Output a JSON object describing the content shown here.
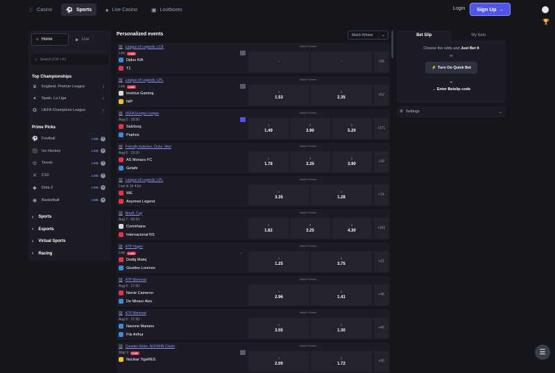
{
  "topnav": [
    {
      "label": "Casino",
      "icon": "casino-icon",
      "glyph": "♢",
      "active": false
    },
    {
      "label": "Sports",
      "icon": "sports-icon",
      "glyph": "⚽",
      "active": true
    },
    {
      "label": "Live Casino",
      "icon": "live-casino-icon",
      "glyph": "♠",
      "active": false
    },
    {
      "label": "Lootboxes",
      "icon": "lootbox-icon",
      "glyph": "▣",
      "active": false
    }
  ],
  "header": {
    "login": "Login",
    "signup": "Sign Up",
    "signup_arrow": "→"
  },
  "left": {
    "home": "Home",
    "live": "Live",
    "search_placeholder": "Search (Ctrl + K)",
    "top_title": "Top Championships",
    "champs": [
      {
        "label": "England. Premier League",
        "icon": "premier-league-icon",
        "glyph": "♛"
      },
      {
        "label": "Spain. La Liga",
        "icon": "la-liga-icon",
        "glyph": "✦"
      },
      {
        "label": "UEFA Champions League",
        "icon": "champions-league-icon",
        "glyph": "✪"
      }
    ],
    "prime_title": "Prime Picks",
    "picks": [
      {
        "label": "Football",
        "icon": "football-icon",
        "glyph": "⚽"
      },
      {
        "label": "Ice Hockey",
        "icon": "hockey-icon",
        "glyph": "⚫"
      },
      {
        "label": "Tennis",
        "icon": "tennis-icon",
        "glyph": "◎"
      },
      {
        "label": "CS2",
        "icon": "cs2-icon",
        "glyph": "✕"
      },
      {
        "label": "Dota 2",
        "icon": "dota-icon",
        "glyph": "◆"
      },
      {
        "label": "Basketball",
        "icon": "basketball-icon",
        "glyph": "◉"
      }
    ],
    "live_badge": "LIVE",
    "plus": "+",
    "cats": [
      "Sports",
      "Esports",
      "Virtual Sports",
      "Racing"
    ]
  },
  "main": {
    "title": "Personalized events",
    "market": "Match Winner",
    "market_label": "Match Winner"
  },
  "events": [
    {
      "league": "League of Legends. LCK",
      "icon": "lol-icon",
      "time": "Live",
      "live": true,
      "t1": "Dplus KIA",
      "t2": "T1",
      "c1": "#3a8ad8",
      "c2": "#e8334a",
      "type": "two",
      "o1": "-",
      "o2": "-",
      "l1": "",
      "l2": "",
      "more": "+58",
      "dash": true,
      "tv": true
    },
    {
      "league": "League of Legends. LPL",
      "icon": "lol-icon",
      "time": "Live",
      "live": true,
      "t1": "Invictus Gaming",
      "t2": "NIP",
      "c1": "#d8d8d8",
      "c2": "#f0c020",
      "type": "two",
      "o1": "1.53",
      "o2": "2.35",
      "l1": "1",
      "l2": "2",
      "more": "+52",
      "tv": true
    },
    {
      "league": "UEFA Europa League",
      "icon": "europa-icon",
      "time": "Aug 6 · 18:00",
      "live": false,
      "t1": "Salzburg",
      "t2": "Paphos",
      "c1": "#e8334a",
      "c2": "#3a8ad8",
      "type": "three",
      "o1": "1.49",
      "ox": "3.90",
      "o2": "5.20",
      "l1": "1",
      "lx": "X",
      "l2": "2",
      "more": "+171",
      "tvblue": true
    },
    {
      "league": "Friendly matches. Clubs. Men",
      "icon": "friendly-icon",
      "time": "Aug 6 · 19:00",
      "live": false,
      "t1": "AS Monaco FC",
      "t2": "Getafe",
      "c1": "#e8334a",
      "c2": "#3a8ad8",
      "type": "three",
      "o1": "1.78",
      "ox": "3.35",
      "o2": "3.90",
      "l1": "1",
      "lx": "X",
      "l2": "2",
      "more": "+39"
    },
    {
      "league": "League of Legends. LPL",
      "icon": "lol-icon",
      "time": "Live in 1h 41m",
      "live": false,
      "t1": "WE",
      "t2": "Anyones Legend",
      "c1": "#e8334a",
      "c2": "#e8334a",
      "type": "two",
      "o1": "3.35",
      "o2": "1.28",
      "l1": "1",
      "l2": "2",
      "more": "+74"
    },
    {
      "league": "Brazil. Cup",
      "icon": "brazil-cup-icon",
      "time": "Aug 7 · 00:00",
      "live": false,
      "t1": "Corinthians",
      "t2": "Internacional RS",
      "c1": "#d8d8d8",
      "c2": "#e8334a",
      "type": "three",
      "o1": "1.82",
      "ox": "3.25",
      "o2": "4.30",
      "l1": "1",
      "lx": "X",
      "l2": "2",
      "more": "+102"
    },
    {
      "league": "ATP Hagen",
      "icon": "atp-icon",
      "time": "Live",
      "live": true,
      "t1": "Dodig Matej",
      "t2": "Giustino Lorenzo",
      "c1": "#e8334a",
      "c2": "#3a8ad8",
      "type": "two",
      "o1": "1.25",
      "o2": "3.75",
      "l1": "1",
      "l2": "2",
      "more": "+21",
      "side": "⇔"
    },
    {
      "league": "ATP Montreal",
      "icon": "atp-icon",
      "time": "Aug 6 · 17:00",
      "live": false,
      "t1": "Norrie Cameron",
      "t2": "De Minaur Alex",
      "c1": "#e8334a",
      "c2": "#3a8ad8",
      "type": "two",
      "o1": "2.96",
      "o2": "1.41",
      "l1": "1",
      "l2": "2",
      "more": "+45"
    },
    {
      "league": "ATP Montreal",
      "icon": "atp-icon",
      "time": "Aug 6 · 17:30",
      "live": false,
      "t1": "Navone Mariano",
      "t2": "Fils Arthur",
      "c1": "#3a8ad8",
      "c2": "#3a8ad8",
      "type": "two",
      "o1": "3.55",
      "o2": "1.30",
      "l1": "1",
      "l2": "2",
      "more": "+45"
    },
    {
      "league": "Counter-Strike. NODWIN Clutch",
      "icon": "cs2-icon",
      "time": "Map 3",
      "live": true,
      "t1": "Nuclear TigeRES",
      "t2": "",
      "c1": "#f0c020",
      "c2": "#3a8ad8",
      "type": "two",
      "o1": "2.00",
      "o2": "1.72",
      "l1": "1",
      "l2": "2",
      "more": "+26",
      "tv": true,
      "mapnote": "Map 3"
    }
  ],
  "slip": {
    "tab1": "Bet Slip",
    "tab2": "My bets",
    "t1a": "Choose the odds and ",
    "t1b": "Just Bet It",
    "t2": "or",
    "quick": "Turn On Quick Bet",
    "quick_icon": "⚡",
    "t3": "or",
    "code": "→ Enter Betslip code"
  },
  "settings": {
    "label": "Settings",
    "icon": "gear-icon"
  },
  "colors": {
    "accent": "#4f55e8",
    "live": "#e8334a",
    "link": "#8f93ff"
  }
}
